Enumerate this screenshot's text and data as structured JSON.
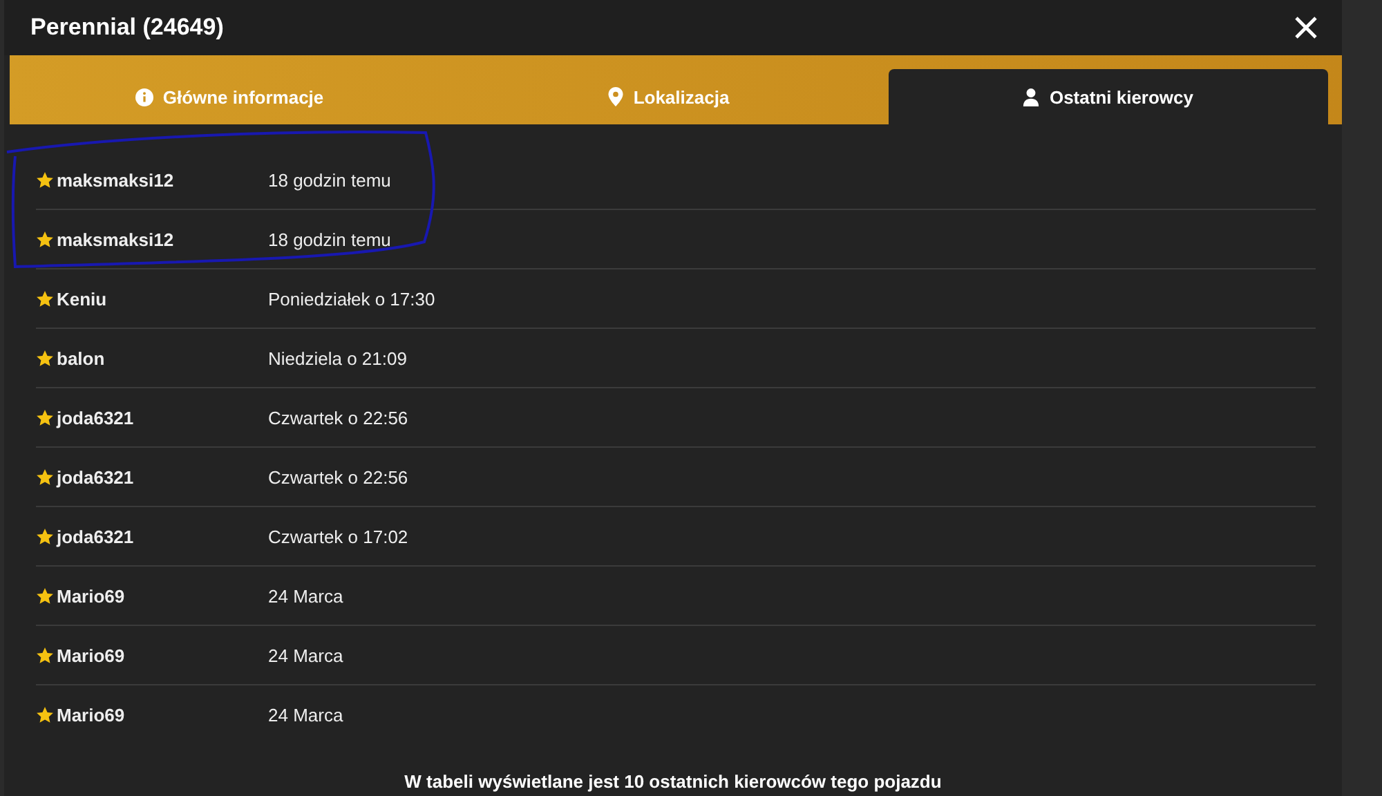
{
  "window": {
    "title": "Perennial (24649)"
  },
  "tabs": [
    {
      "label": "Główne informacje",
      "kind": "info",
      "selected": false
    },
    {
      "label": "Lokalizacja",
      "kind": "location",
      "selected": false
    },
    {
      "label": "Ostatni kierowcy",
      "kind": "drivers",
      "selected": true
    }
  ],
  "drivers": [
    {
      "name": "maksmaksi12",
      "time": "18 godzin temu"
    },
    {
      "name": "maksmaksi12",
      "time": "18 godzin temu"
    },
    {
      "name": "Keniu",
      "time": "Poniedziałek o 17:30"
    },
    {
      "name": "balon",
      "time": "Niedziela o 21:09"
    },
    {
      "name": "joda6321",
      "time": "Czwartek o 22:56"
    },
    {
      "name": "joda6321",
      "time": "Czwartek o 22:56"
    },
    {
      "name": "joda6321",
      "time": "Czwartek o 17:02"
    },
    {
      "name": "Mario69",
      "time": "24 Marca"
    },
    {
      "name": "Mario69",
      "time": "24 Marca"
    },
    {
      "name": "Mario69",
      "time": "24 Marca"
    }
  ],
  "footer": "W tabeli wyświetlane jest 10 ostatnich kierowców tego pojazdu"
}
